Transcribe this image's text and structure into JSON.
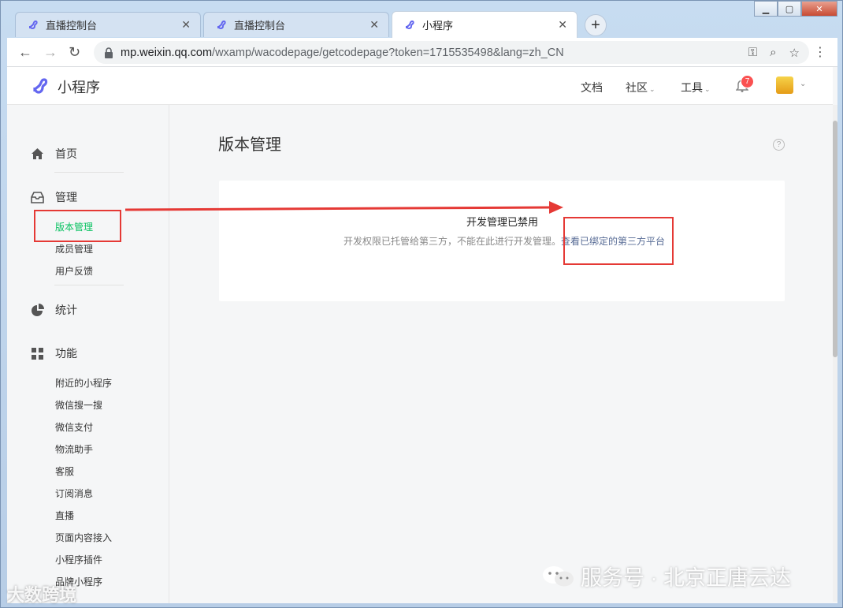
{
  "browser": {
    "tabs": [
      {
        "label": "直播控制台",
        "active": false
      },
      {
        "label": "直播控制台",
        "active": false
      },
      {
        "label": "小程序",
        "active": true
      }
    ],
    "url_host": "mp.weixin.qq.com",
    "url_path": "/wxamp/wacodepage/getcodepage?token=1715535498&lang=zh_CN"
  },
  "header": {
    "brand": "小程序",
    "nav": [
      {
        "label": "文档",
        "caret": false
      },
      {
        "label": "社区",
        "caret": true
      },
      {
        "label": "工具",
        "caret": true
      }
    ],
    "notification_count": "7"
  },
  "sidebar": {
    "home": "首页",
    "manage": "管理",
    "manage_items": [
      "版本管理",
      "成员管理",
      "用户反馈"
    ],
    "stats": "统计",
    "features": "功能",
    "feature_items": [
      "附近的小程序",
      "微信搜一搜",
      "微信支付",
      "物流助手",
      "客服",
      "订阅消息",
      "直播",
      "页面内容接入",
      "小程序插件",
      "品牌小程序"
    ]
  },
  "main": {
    "title": "版本管理",
    "card_title": "开发管理已禁用",
    "card_desc": "开发权限已托管给第三方，不能在此进行开发管理。",
    "card_link": "查看已绑定的第三方平台"
  },
  "watermarks": {
    "service": "服务号 · 北京正唐云达",
    "corner": "大数跨境"
  },
  "colors": {
    "accent_green": "#07c160",
    "link": "#576b95",
    "annotation_red": "#e53935",
    "badge": "#fa5151"
  }
}
